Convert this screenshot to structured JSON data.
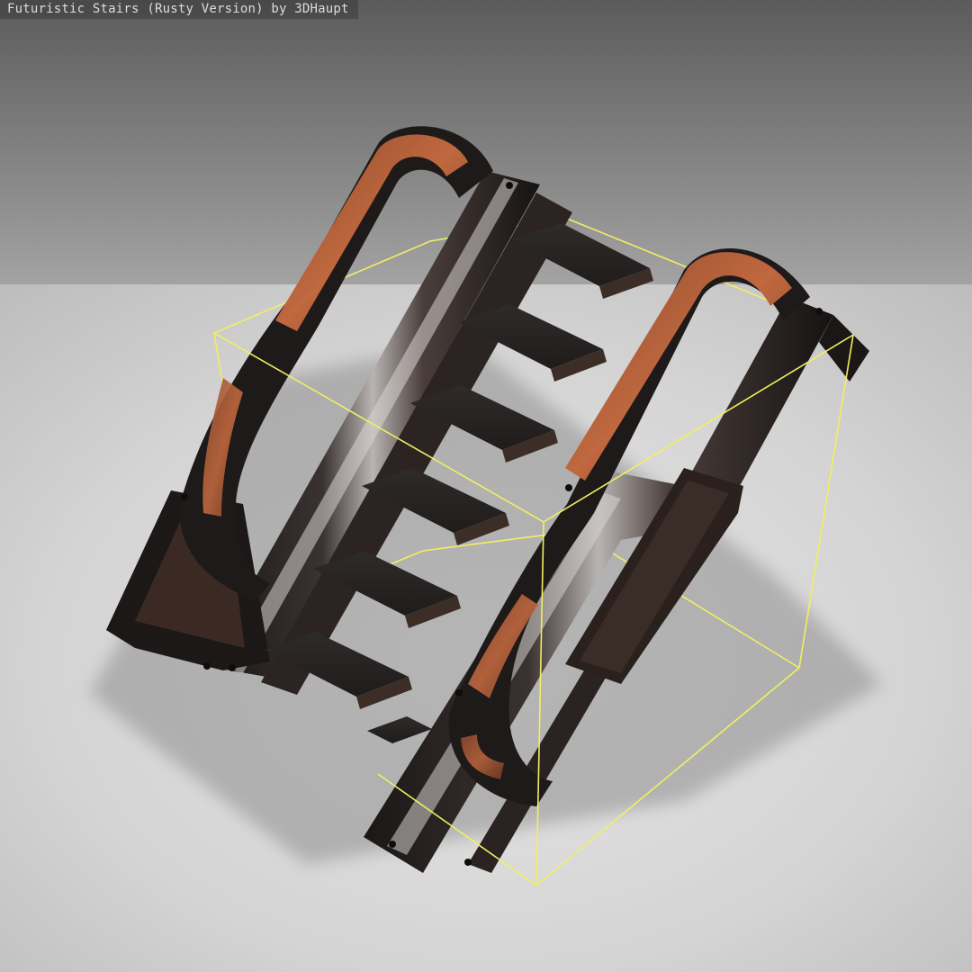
{
  "viewer": {
    "title": "Futuristic Stairs (Rusty Version) by 3DHaupt"
  },
  "scene": {
    "model_name": "futuristic-stairs",
    "selection_box_color": "#f2ee62",
    "rust_color": "#b0552b",
    "metal_dark_color": "#1e1b1a",
    "metal_light_color": "#9a9a9a",
    "background_top_color": "#5e5e5e",
    "background_horizon_color": "#a0a0a0",
    "floor_color": "#d9d9d9"
  }
}
